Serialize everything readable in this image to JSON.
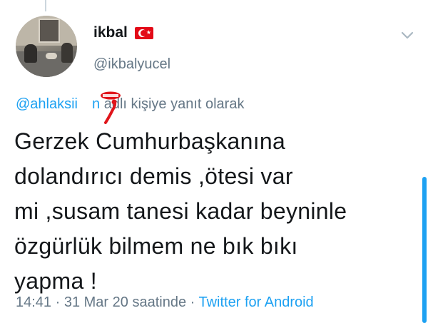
{
  "user": {
    "display_name": "ikbal",
    "flag": "turkey-flag-icon",
    "handle": "@ikbalyucel"
  },
  "reply_context": {
    "mention": "@ahlaksii",
    "mention_end": "n",
    "suffix": " adlı kişiye yanıt olarak"
  },
  "tweet": {
    "text": "Gerzek Cumhurbaşkanına\ndolandırıcı demis ,ötesi var\nmi ,susam tanesi kadar beyninle\nözgürlük bilmem ne bık bıkı\nyapma !"
  },
  "meta": {
    "time": "14:41",
    "separator1": " · ",
    "date_prefix": "31 Mar 20 saatinde",
    "separator2": " · ",
    "source": "Twitter for Android"
  },
  "colors": {
    "accent": "#1da1f2",
    "secondary_text": "#657786",
    "primary_text": "#14171a",
    "censor_red": "#e0151b"
  }
}
